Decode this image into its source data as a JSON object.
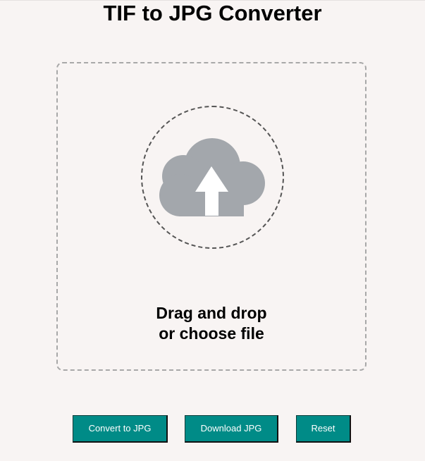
{
  "header": {
    "title": "TIF to JPG Converter"
  },
  "dropzone": {
    "line1": "Drag and drop",
    "line2": "or choose file",
    "icon": "cloud-upload-icon"
  },
  "buttons": {
    "convert_label": "Convert to JPG",
    "download_label": "Download JPG",
    "reset_label": "Reset"
  },
  "colors": {
    "background": "#f8f4f3",
    "button": "#008b87",
    "icon": "#a3a7ac"
  }
}
